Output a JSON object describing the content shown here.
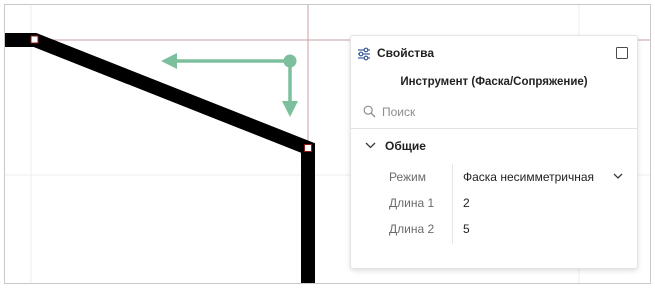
{
  "panel": {
    "title": "Свойства",
    "tool_name": "Инструмент (Фаска/Сопряжение)",
    "search": {
      "placeholder": "Поиск",
      "value": ""
    },
    "section": {
      "label": "Общие",
      "properties": [
        {
          "label": "Режим",
          "value": "Фаска несимметричная",
          "type": "select"
        },
        {
          "label": "Длина 1",
          "value": "2",
          "type": "text"
        },
        {
          "label": "Длина 2",
          "value": "5",
          "type": "text"
        }
      ]
    }
  },
  "icons": {
    "properties_icon": "sliders-icon",
    "maximize_icon": "square-icon",
    "search_icon": "search-icon",
    "section_toggle": "chevron-down-icon",
    "select_dropdown": "chevron-down-icon"
  },
  "colors": {
    "trace": "#000000",
    "arrow": "#7bbf9c",
    "grid": "#eeeeee",
    "crosshair": "#c8a0a0",
    "vertex_marker_border": "#8b1a1a"
  }
}
